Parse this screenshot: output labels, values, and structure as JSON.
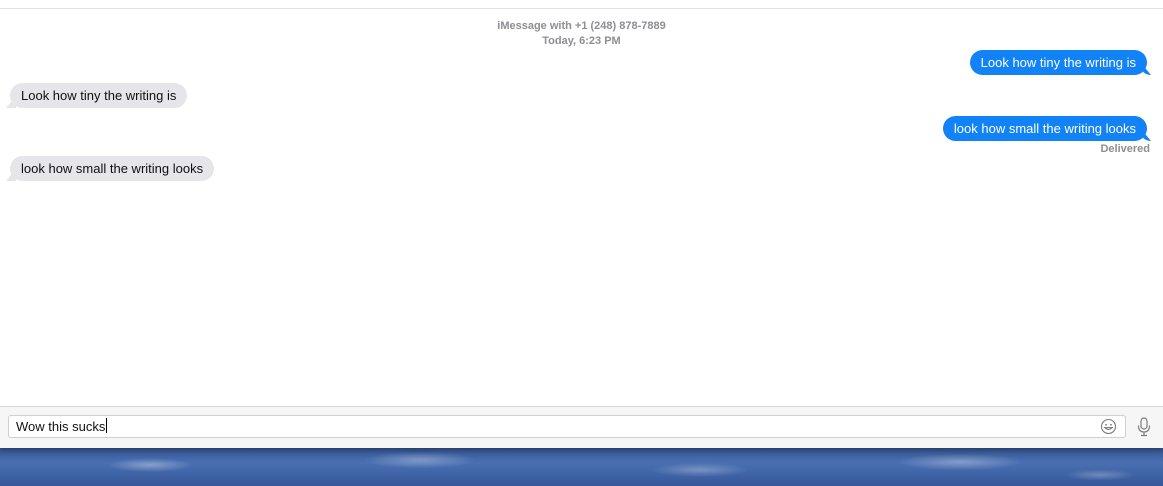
{
  "conversation": {
    "header_line1": "iMessage with +1 (248) 878-7889",
    "header_line2": "Today, 6:23 PM"
  },
  "messages": [
    {
      "direction": "sent",
      "text": "Look how tiny the writing is"
    },
    {
      "direction": "received",
      "text": "Look how tiny the writing is"
    },
    {
      "direction": "sent",
      "text": "look how small the writing looks"
    },
    {
      "direction": "received",
      "text": "look how small the writing looks"
    }
  ],
  "delivery_status": "Delivered",
  "compose": {
    "value": "Wow this sucks"
  },
  "icons": {
    "emoji": "emoji-icon",
    "mic": "microphone-icon"
  },
  "colors": {
    "sent_bubble": "#1283f7",
    "received_bubble": "#e5e5ea",
    "meta_text": "#8e8e93"
  }
}
